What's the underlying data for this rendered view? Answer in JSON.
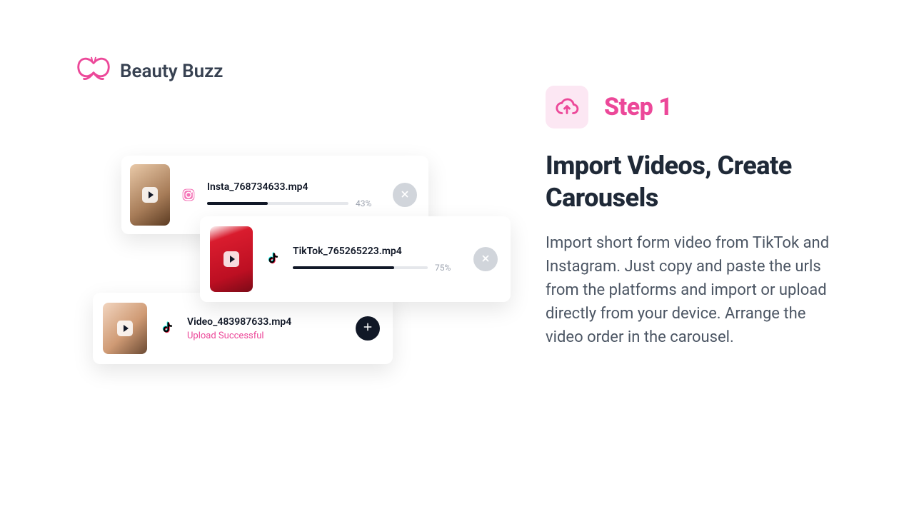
{
  "brand": {
    "name": "Beauty Buzz",
    "accent_color": "#EC4899"
  },
  "uploads": [
    {
      "source": "instagram",
      "filename": "Insta_768734633.mp4",
      "progress_percent": 43,
      "progress_label": "43%",
      "status": "uploading",
      "action": "close"
    },
    {
      "source": "tiktok",
      "filename": "TikTok_765265223.mp4",
      "progress_percent": 75,
      "progress_label": "75%",
      "status": "uploading",
      "action": "close"
    },
    {
      "source": "tiktok",
      "filename": "Video_483987633.mp4",
      "progress_percent": 100,
      "status": "done",
      "status_label": "Upload Successful",
      "action": "add"
    }
  ],
  "step": {
    "badge": "Step 1",
    "headline": "Import Videos, Create Carousels",
    "body": "Import short form video from TikTok and Instagram. Just copy and paste the urls from the platforms and import or upload directly from your device. Arrange the video order in the carousel."
  }
}
